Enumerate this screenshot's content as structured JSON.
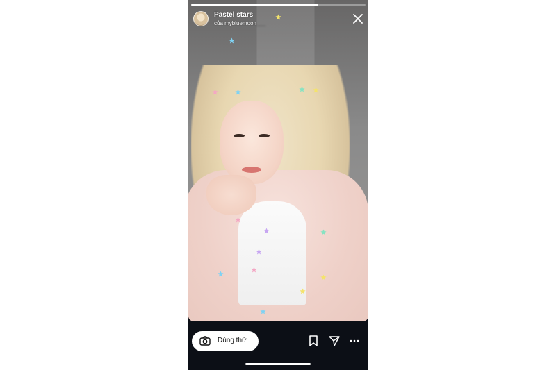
{
  "story": {
    "title": "Pastel stars",
    "subtitle": "của mybluemoon___",
    "progress": 0.73
  },
  "actions": {
    "try_label": "Dùng thử"
  },
  "icons": {
    "close": "close-icon",
    "camera": "camera-icon",
    "bookmark": "bookmark-icon",
    "share": "send-icon",
    "more": "more-icon"
  },
  "colors": {
    "background": "#0c0f16",
    "star_yellow": "#f4e36b",
    "star_blue": "#7fd2f3",
    "star_pink": "#f4a7c4",
    "star_mint": "#86e3c2",
    "star_lilac": "#c7a6f2"
  },
  "stars": [
    {
      "color": "#f4e36b"
    },
    {
      "color": "#7fd2f3"
    },
    {
      "color": "#f4a7c4"
    },
    {
      "color": "#7fd2f3"
    },
    {
      "color": "#86e3c2"
    },
    {
      "color": "#f4e36b"
    },
    {
      "color": "#f4a7c4"
    },
    {
      "color": "#c7a6f2"
    },
    {
      "color": "#c7a6f2"
    },
    {
      "color": "#86e3c2"
    },
    {
      "color": "#f4a7c4"
    },
    {
      "color": "#7fd2f3"
    },
    {
      "color": "#f4e36b"
    },
    {
      "color": "#f4e36b"
    },
    {
      "color": "#7fd2f3"
    }
  ]
}
